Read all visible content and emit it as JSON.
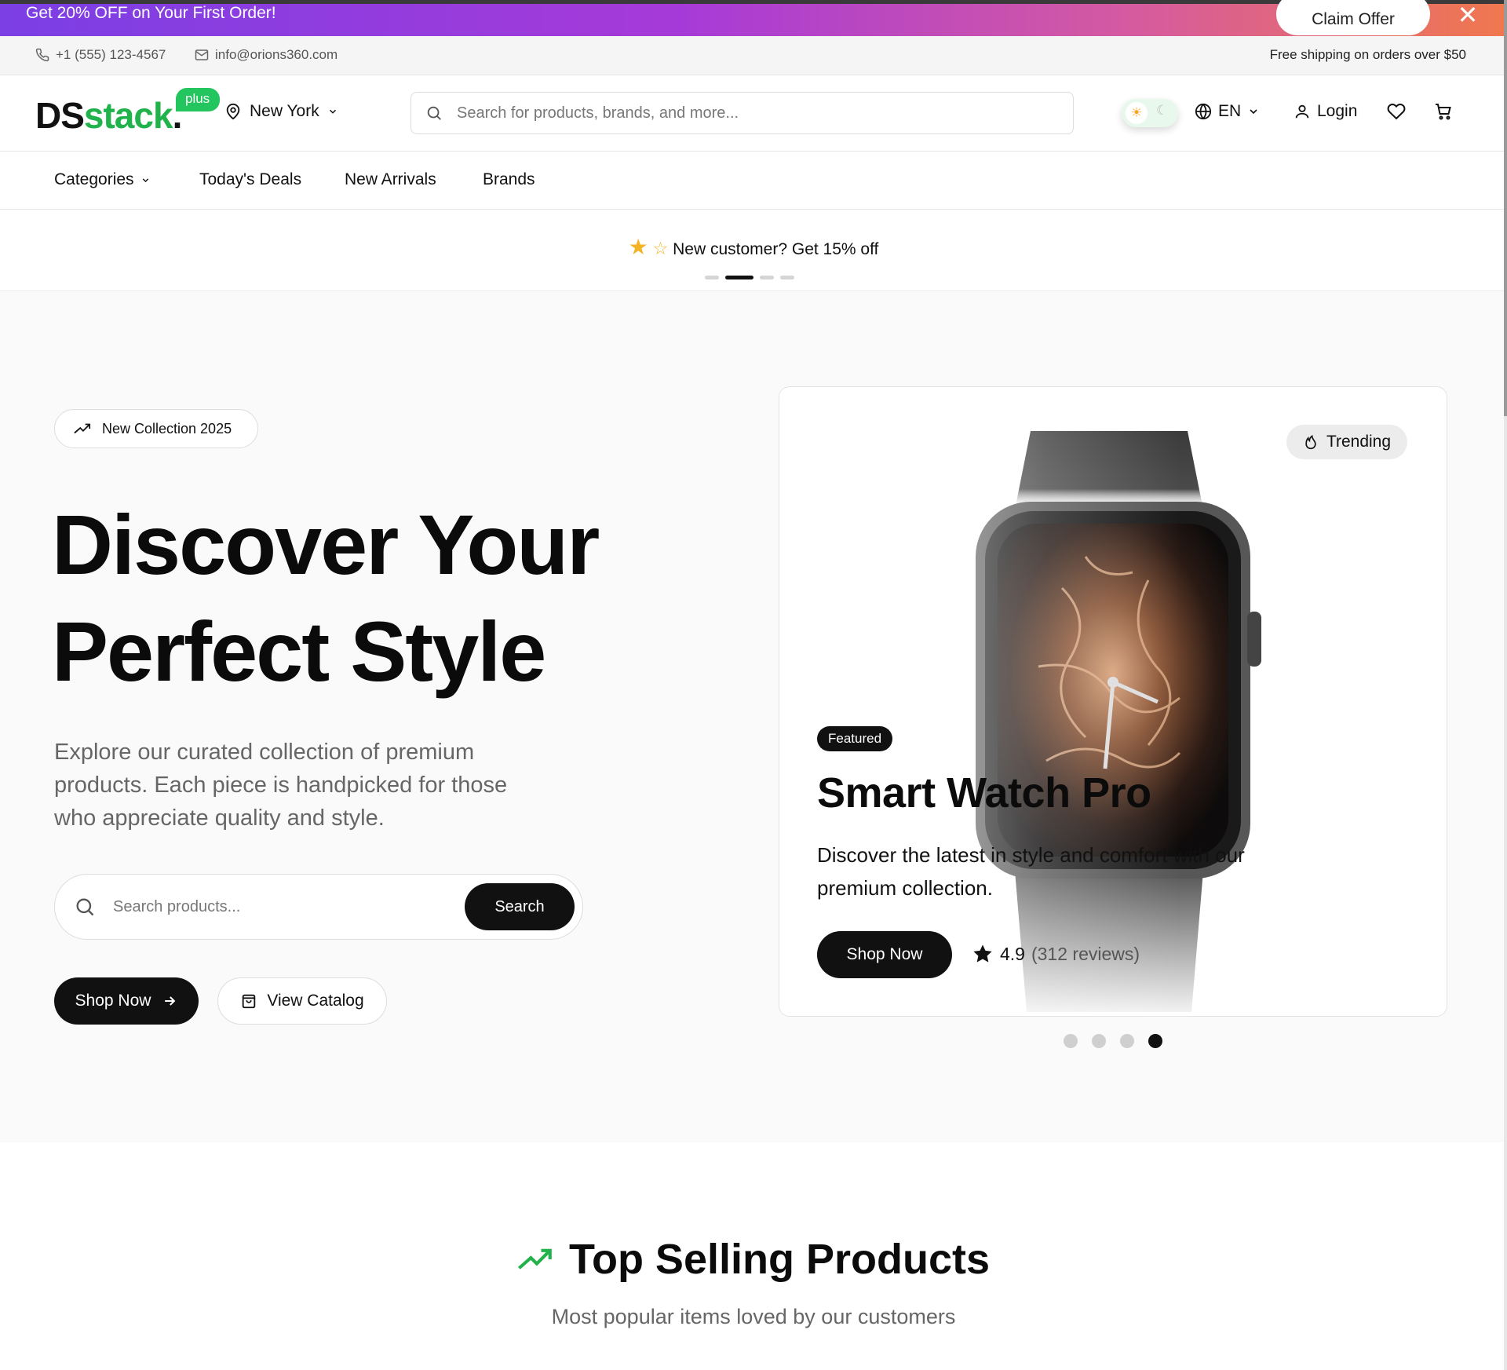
{
  "promo": {
    "text": "Get 20% OFF on Your First Order!",
    "button": "Claim Offer",
    "close": "✕"
  },
  "contact": {
    "phone": "+1 (555) 123-4567",
    "email": "info@orions360.com",
    "shipping": "Free shipping on orders over $50"
  },
  "header": {
    "logo_ds": "DS",
    "logo_stack": "stack",
    "logo_dot": ".",
    "logo_badge": "plus",
    "location": "New York",
    "search_placeholder": "Search for products, brands, and more...",
    "language": "EN",
    "login": "Login"
  },
  "nav": {
    "categories": "Categories",
    "deals": "Today's Deals",
    "arrivals": "New Arrivals",
    "brands": "Brands"
  },
  "announcement": {
    "text": "New customer? Get 15% off",
    "slides": 4,
    "active_slide": 2
  },
  "hero": {
    "badge": "New Collection 2025",
    "title_line1": "Discover Your",
    "title_line2": "Perfect Style",
    "subtitle": "Explore our curated collection of premium products. Each piece is handpicked for those who appreciate quality and style.",
    "search_placeholder": "Search products...",
    "search_button": "Search",
    "shop_now": "Shop Now",
    "view_catalog": "View Catalog"
  },
  "featured_card": {
    "trending": "Trending",
    "badge": "Featured",
    "title": "Smart Watch Pro",
    "description": "Discover the latest in style and comfort with our premium collection.",
    "button": "Shop Now",
    "rating": "4.9",
    "reviews": "(312 reviews)",
    "slides": 4,
    "active_slide": 4
  },
  "top_selling": {
    "title": "Top Selling Products",
    "subtitle": "Most popular items loved by our customers"
  },
  "colors": {
    "brand_green": "#22b24c",
    "primary_dark": "#111111",
    "promo_gradient_start": "#7b3fe4",
    "promo_gradient_end": "#f0784e",
    "star": "#f5b324"
  }
}
